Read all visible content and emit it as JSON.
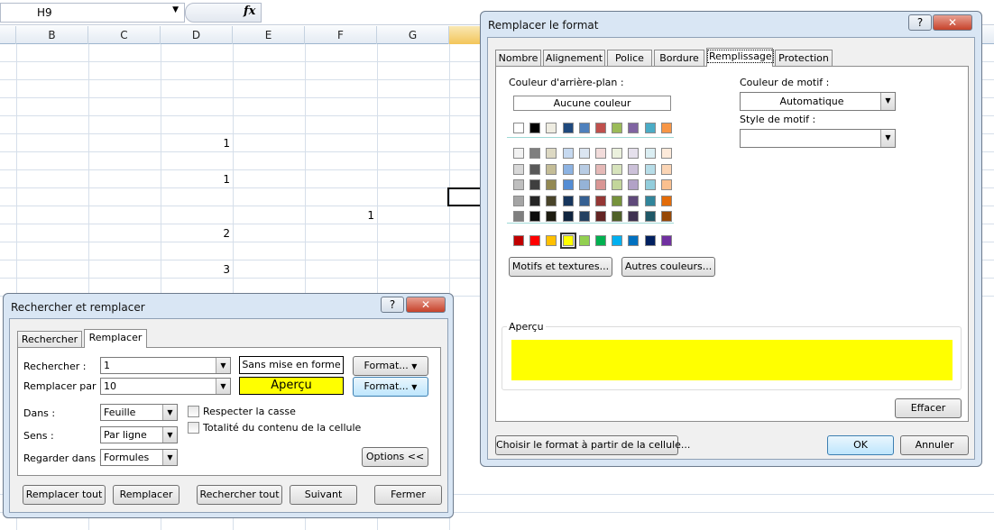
{
  "excel": {
    "namebox": "H9",
    "fx_label": "fx",
    "columns": [
      "B",
      "C",
      "D",
      "E",
      "F",
      "G"
    ],
    "cells": [
      {
        "value": "1"
      },
      {
        "value": "1"
      },
      {
        "value": "1"
      },
      {
        "value": "2"
      },
      {
        "value": "3"
      }
    ]
  },
  "format_dialog": {
    "title": "Remplacer le format",
    "help": "?",
    "close": "✕",
    "tabs": [
      "Nombre",
      "Alignement",
      "Police",
      "Bordure",
      "Remplissage",
      "Protection"
    ],
    "selected_tab": "Remplissage",
    "bg_color_label": "Couleur d'arrière-plan :",
    "no_color": "Aucune couleur",
    "pattern_color_label": "Couleur de motif :",
    "pattern_color_value": "Automatique",
    "pattern_style_label": "Style de motif :",
    "pattern_style_value": "",
    "motifs_button": "Motifs et textures...",
    "more_colors_button": "Autres couleurs...",
    "preview_label": "Aperçu",
    "preview_color": "#ffff00",
    "clear_button": "Effacer",
    "choose_button": "Choisir le format à partir de la cellule...",
    "ok_button": "OK",
    "cancel_button": "Annuler",
    "theme_top": [
      "#ffffff",
      "#000000",
      "#eeece1",
      "#1f497d",
      "#4f81bd",
      "#c0504d",
      "#9bbb59",
      "#8064a2",
      "#4bacc6",
      "#f79646"
    ],
    "theme_rows": [
      [
        "#f2f2f2",
        "#7f7f7f",
        "#ddd9c3",
        "#c6d9f0",
        "#dbe5f1",
        "#f2dcdb",
        "#ebf1dd",
        "#e5e0ec",
        "#dbeef3",
        "#fdeada"
      ],
      [
        "#d8d8d8",
        "#595959",
        "#c4bd97",
        "#8db3e2",
        "#b8cce4",
        "#e5b9b7",
        "#d7e3bc",
        "#ccc1d9",
        "#b7dde8",
        "#fbd5b5"
      ],
      [
        "#bfbfbf",
        "#3f3f3f",
        "#938953",
        "#548dd4",
        "#95b3d7",
        "#d99694",
        "#c3d69b",
        "#b2a2c7",
        "#92cddc",
        "#fac08f"
      ],
      [
        "#a5a5a5",
        "#262626",
        "#494429",
        "#17365d",
        "#366092",
        "#953734",
        "#76923c",
        "#5f497a",
        "#31859b",
        "#e36c09"
      ],
      [
        "#7f7f7f",
        "#0c0c0c",
        "#1d1b10",
        "#0f243e",
        "#244061",
        "#632423",
        "#4f6128",
        "#3f3151",
        "#205867",
        "#974806"
      ]
    ],
    "standard": [
      "#c00000",
      "#ff0000",
      "#ffc000",
      "#ffff00",
      "#92d050",
      "#00b050",
      "#00b0f0",
      "#0070c0",
      "#002060",
      "#7030a0"
    ],
    "selected_standard_index": 3
  },
  "find_dialog": {
    "title": "Rechercher et remplacer",
    "help": "?",
    "close": "✕",
    "tabs": [
      "Rechercher",
      "Remplacer"
    ],
    "selected_tab": "Remplacer",
    "search_label": "Rechercher :",
    "search_value": "1",
    "replace_label": "Remplacer par :",
    "replace_value": "10",
    "no_format": "Sans mise en forme",
    "preview_text": "Aperçu",
    "preview_color": "#ffff00",
    "format_button": "Format...",
    "format_button2": "Format...",
    "dans_label": "Dans :",
    "dans_value": "Feuille",
    "sens_label": "Sens :",
    "sens_value": "Par ligne",
    "regarder_label": "Regarder dans :",
    "regarder_value": "Formules",
    "case_label": "Respecter la casse",
    "whole_label": "Totalité du contenu de la cellule",
    "options_button": "Options <<",
    "replace_all": "Remplacer tout",
    "replace": "Remplacer",
    "find_all": "Rechercher tout",
    "next": "Suivant",
    "close_button": "Fermer"
  }
}
